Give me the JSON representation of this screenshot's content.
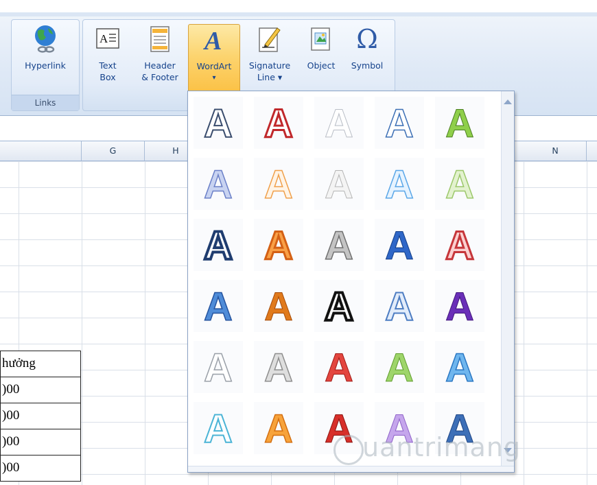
{
  "ribbon": {
    "links_group": {
      "caption": "Links",
      "hyperlink_label": "Hyperlink"
    },
    "text_group": {
      "text_box_label_1": "Text",
      "text_box_label_2": "Box",
      "header_footer_label_1": "Header",
      "header_footer_label_2": "& Footer",
      "wordart_label": "WordArt",
      "wordart_arrow": "▾",
      "signature_label_1": "Signature",
      "signature_label_2": "Line ▾",
      "object_label": "Object",
      "symbol_label": "Symbol",
      "symbol_glyph": "Ω"
    }
  },
  "sheet": {
    "columns": [
      "G",
      "H",
      "N"
    ],
    "cells": [
      "hưởng",
      ")00",
      ")00",
      ")00",
      ")00"
    ]
  },
  "gallery": {
    "tile_letter": "A",
    "styles": [
      [
        "outline-white",
        "red-outline",
        "white-shadow",
        "blue-outline",
        "green-gradient"
      ],
      [
        "lavender-shadow",
        "orange-light",
        "gray-light",
        "sky-blue",
        "light-green"
      ],
      [
        "navy-outline",
        "orange-bold",
        "silver",
        "blue-bevel",
        "red-stripe"
      ],
      [
        "blue-gradient",
        "orange-solid",
        "black-outline",
        "blue-white",
        "purple-reflect"
      ],
      [
        "white-3d",
        "gray-3d",
        "red-3d",
        "green-3d",
        "blue-3d"
      ],
      [
        "cyan-outline",
        "orange-glow",
        "red-reflect",
        "purple-soft",
        "blue-reflect"
      ]
    ]
  },
  "watermark": {
    "text": "uantrimang"
  }
}
